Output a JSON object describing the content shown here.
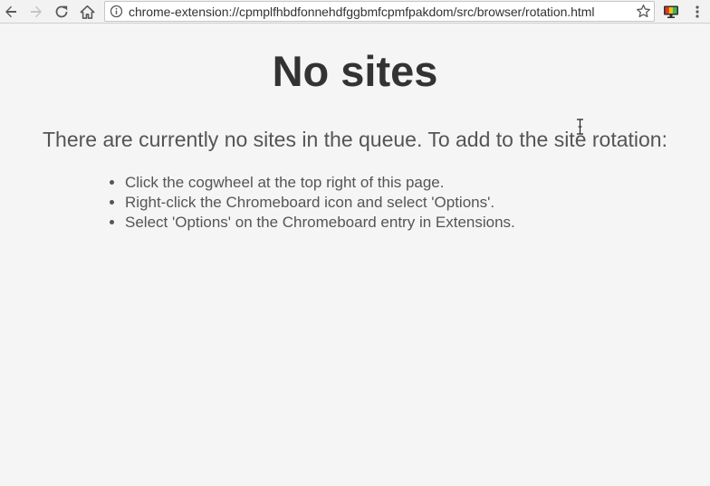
{
  "browser": {
    "url": "chrome-extension://cpmplfhbdfonnehdfggbmfcpmfpakdom/src/browser/rotation.html",
    "icons": {
      "back": "arrow-left-icon",
      "forward": "arrow-right-icon",
      "reload": "reload-icon",
      "home": "home-icon",
      "site_info": "info-icon",
      "bookmark": "star-icon",
      "extension": "chromeboard-extension-icon",
      "menu": "kebab-menu-icon"
    },
    "colors": {
      "toolbar": "#f2f2f2",
      "icon_active": "#5a5a5a",
      "icon_disabled": "#c4c4c4"
    }
  },
  "page": {
    "title": "No sites",
    "subtitle": "There are currently no sites in the queue. To add to the site rotation:",
    "instructions": [
      "Click the cogwheel at the top right of this page.",
      "Right-click the Chromeboard icon and select 'Options'.",
      "Select 'Options' on the Chromeboard entry in Extensions."
    ],
    "colors": {
      "background": "#f5f5f5",
      "title": "#333333",
      "text": "#555555"
    }
  }
}
